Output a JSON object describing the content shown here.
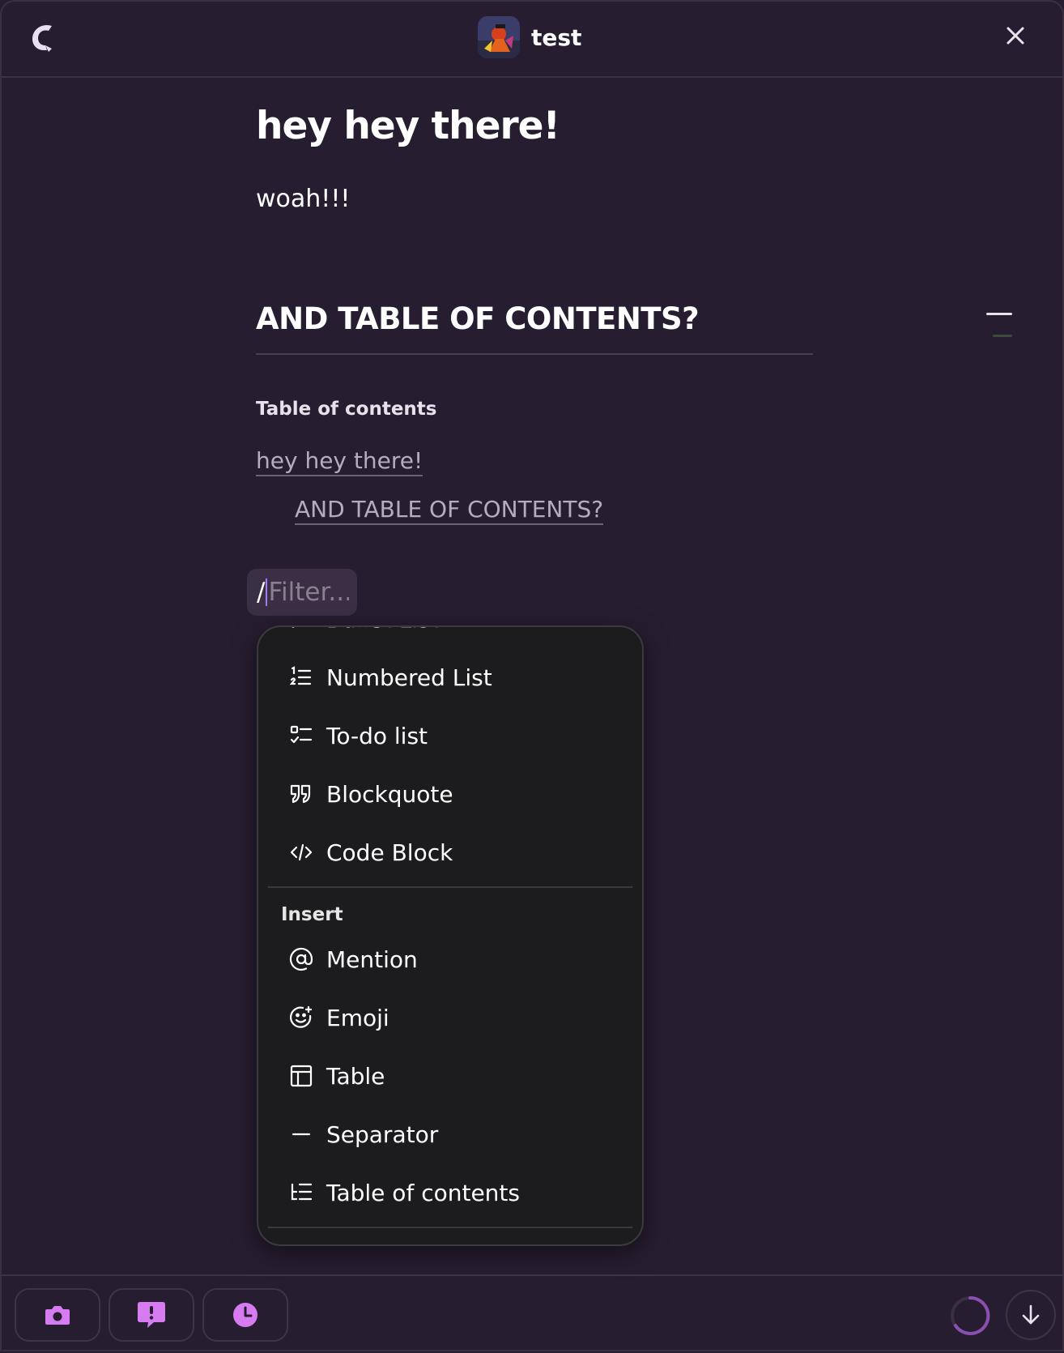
{
  "header": {
    "doc_title": "test",
    "logo_icon": "app-logo-icon",
    "close_icon": "close-icon"
  },
  "document": {
    "heading1": "hey hey there!",
    "paragraph": "woah!!!",
    "heading2": "AND TABLE OF CONTENTS?",
    "toc": {
      "label": "Table of contents",
      "entries": [
        "hey hey there!",
        "AND TABLE OF CONTENTS?"
      ]
    }
  },
  "slash_command": {
    "prefix": "/",
    "placeholder": "Filter..."
  },
  "menu": {
    "items": [
      {
        "label": "Bullet List",
        "icon": "bullet-list-icon"
      },
      {
        "label": "Numbered List",
        "icon": "numbered-list-icon"
      },
      {
        "label": "To-do list",
        "icon": "todo-list-icon"
      },
      {
        "label": "Blockquote",
        "icon": "blockquote-icon"
      },
      {
        "label": "Code Block",
        "icon": "code-icon"
      }
    ],
    "insert_section": "Insert",
    "insert_items": [
      {
        "label": "Mention",
        "icon": "at-sign-icon"
      },
      {
        "label": "Emoji",
        "icon": "emoji-icon"
      },
      {
        "label": "Table",
        "icon": "table-icon"
      },
      {
        "label": "Separator",
        "icon": "separator-icon"
      },
      {
        "label": "Table of contents",
        "icon": "table-of-contents-icon"
      }
    ]
  },
  "bottom_bar": {
    "buttons": [
      "camera-icon",
      "feedback-icon",
      "clock-icon"
    ],
    "accent_color": "#d67cf0"
  },
  "colors": {
    "background": "#271d30",
    "menu_background": "#1c1b1d",
    "caret": "#9f7cf0"
  }
}
